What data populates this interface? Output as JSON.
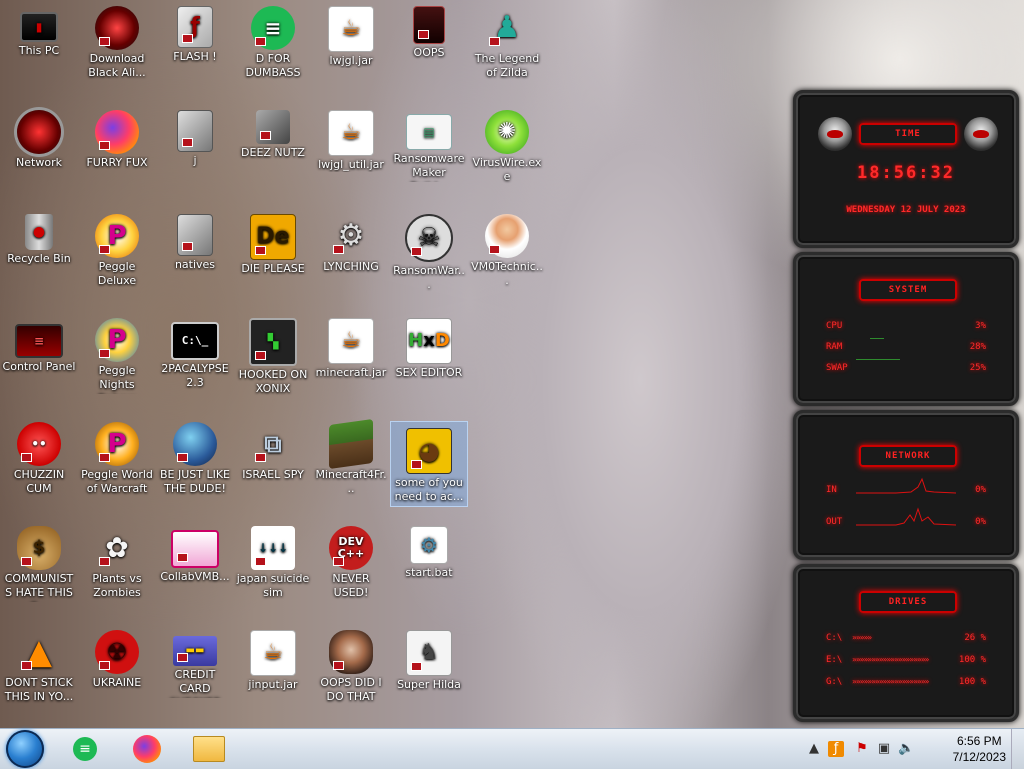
{
  "desktop_icons": [
    {
      "label": "This PC"
    },
    {
      "label": "Download Black Ali..."
    },
    {
      "label": "FLASH !"
    },
    {
      "label": "D FOR DUMBASS"
    },
    {
      "label": "lwjgl.jar"
    },
    {
      "label": "OOPS"
    },
    {
      "label": "The Legend of Zilda"
    },
    {
      "label": "Network"
    },
    {
      "label": "FURRY FUX"
    },
    {
      "label": "j"
    },
    {
      "label": "DEEZ NUTZ"
    },
    {
      "label": "lwjgl_util.jar"
    },
    {
      "label": "Ransomware Maker Build..."
    },
    {
      "label": "VirusWire.exe"
    },
    {
      "label": "Recycle Bin"
    },
    {
      "label": "Peggle Deluxe"
    },
    {
      "label": "natives"
    },
    {
      "label": "DIE PLEASE"
    },
    {
      "label": "LYNCHING"
    },
    {
      "label": "RansomWar..."
    },
    {
      "label": "VM0Technic..."
    },
    {
      "label": "Control Panel"
    },
    {
      "label": "Peggle Nights Deluxe"
    },
    {
      "label": "2PACALYPSE 2.3"
    },
    {
      "label": "HOOKED ON XONIX"
    },
    {
      "label": "minecraft.jar"
    },
    {
      "label": "SEX EDITOR"
    },
    {
      "label": "CHUZZIN CUM"
    },
    {
      "label": "Peggle World of Warcraft ..."
    },
    {
      "label": "BE JUST LIKE THE DUDE!"
    },
    {
      "label": "ISRAEL SPY"
    },
    {
      "label": "Minecraft4Fr..."
    },
    {
      "label": "some of you need to ac..."
    },
    {
      "label": "COMMUNISTS HATE THIS G..."
    },
    {
      "label": "Plants vs Zombies"
    },
    {
      "label": "CollabVMB..."
    },
    {
      "label": "japan suicide sim"
    },
    {
      "label": "NEVER USED!"
    },
    {
      "label": "start.bat"
    },
    {
      "label": "DONT STICK THIS IN YO..."
    },
    {
      "label": "UKRAINE"
    },
    {
      "label": "CREDIT CARD CHECKER"
    },
    {
      "label": "jinput.jar"
    },
    {
      "label": "OOPS DID I DO THAT"
    },
    {
      "label": "Super Hilda"
    }
  ],
  "gadget": {
    "time_title": "TIME",
    "time": "18:56:32",
    "date": "WEDNESDAY 12 JULY 2023",
    "system_title": "SYSTEM",
    "system_rows": [
      {
        "label": "CPU",
        "value": "3%"
      },
      {
        "label": "RAM",
        "value": "28%"
      },
      {
        "label": "SWAP",
        "value": "25%"
      }
    ],
    "network_title": "NETWORK",
    "network_rows": [
      {
        "label": "IN",
        "value": "0%"
      },
      {
        "label": "OUT",
        "value": "0%"
      }
    ],
    "drives_title": "DRIVES",
    "drive_rows": [
      {
        "label": "C:\\",
        "value": "26 %"
      },
      {
        "label": "E:\\",
        "value": "100 %"
      },
      {
        "label": "G:\\",
        "value": "100 %"
      }
    ]
  },
  "taskbar": {
    "clock_time": "6:56 PM",
    "clock_date": "7/12/2023"
  }
}
